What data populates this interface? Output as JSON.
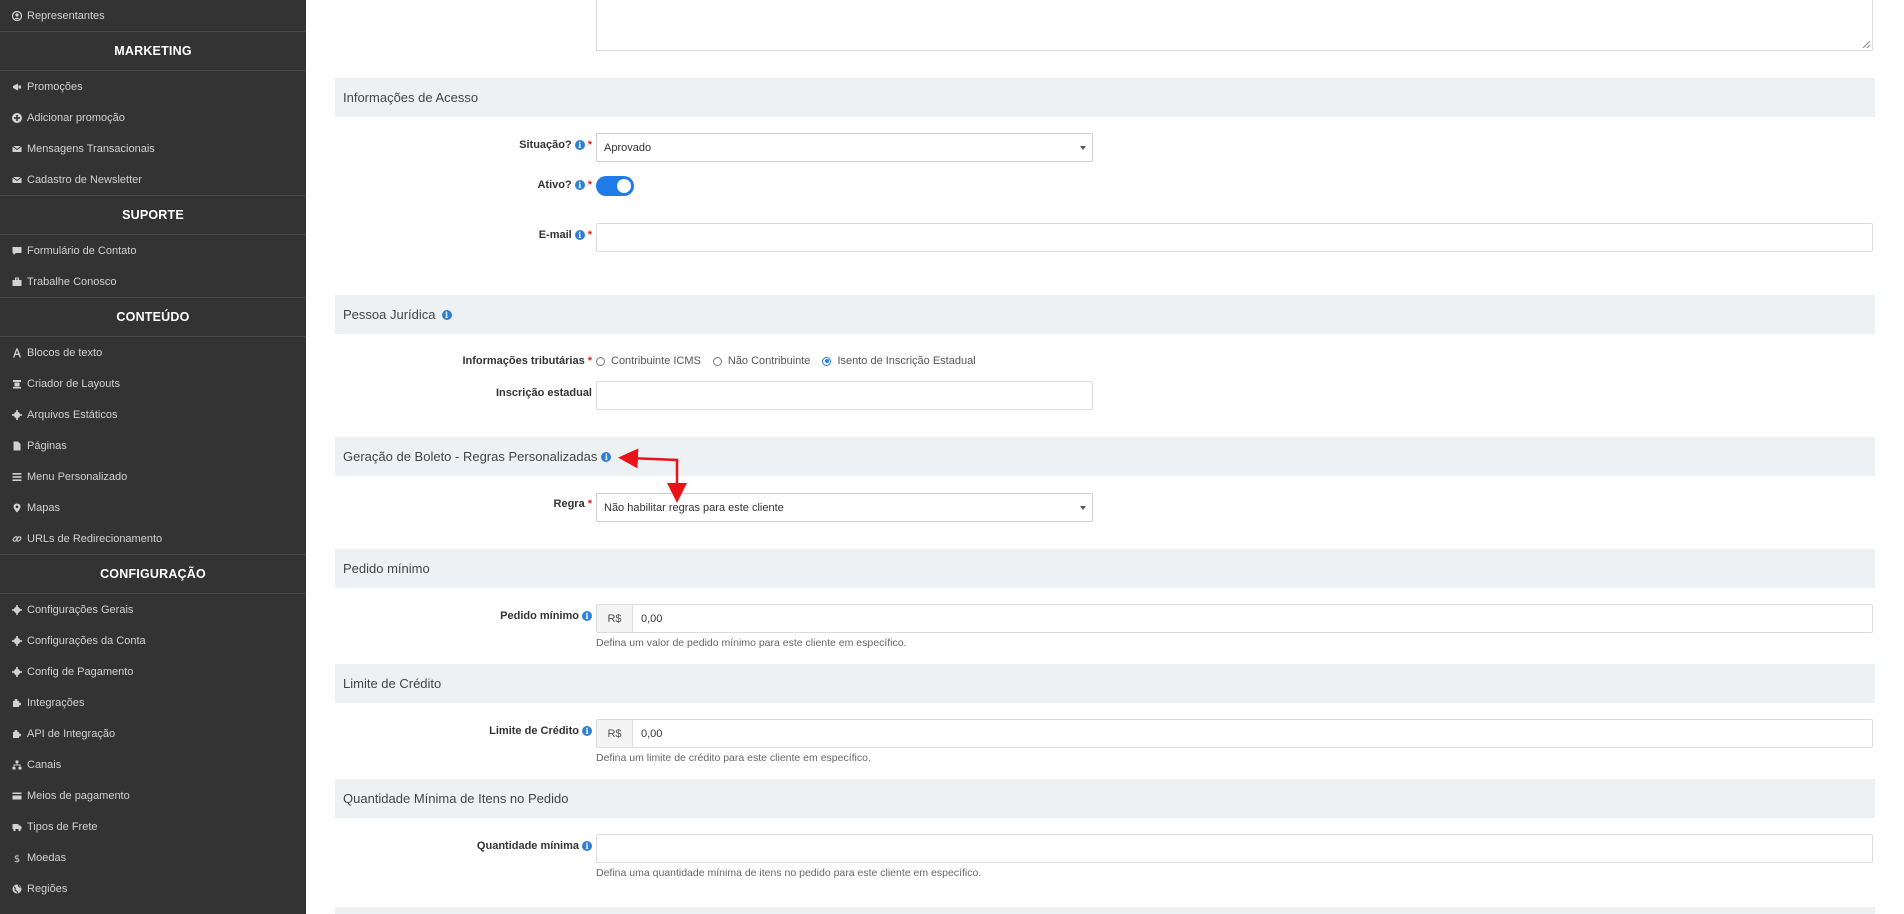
{
  "sidebar": {
    "entries": [
      {
        "kind": "item",
        "label": "Representantes",
        "icon": "user-circle-icon"
      },
      {
        "kind": "header",
        "label": "MARKETING"
      },
      {
        "kind": "item",
        "label": "Promoções",
        "icon": "megaphone-icon"
      },
      {
        "kind": "item",
        "label": "Adicionar promoção",
        "icon": "plus-circle-icon"
      },
      {
        "kind": "item",
        "label": "Mensagens Transacionais",
        "icon": "envelope-icon"
      },
      {
        "kind": "item",
        "label": "Cadastro de Newsletter",
        "icon": "envelope-icon"
      },
      {
        "kind": "header",
        "label": "SUPORTE"
      },
      {
        "kind": "item",
        "label": "Formulário de Contato",
        "icon": "comment-icon"
      },
      {
        "kind": "item",
        "label": "Trabalhe Conosco",
        "icon": "briefcase-icon"
      },
      {
        "kind": "header",
        "label": "CONTEÚDO"
      },
      {
        "kind": "item",
        "label": "Blocos de texto",
        "icon": "font-icon"
      },
      {
        "kind": "item",
        "label": "Criador de Layouts",
        "icon": "layout-icon"
      },
      {
        "kind": "item",
        "label": "Arquivos Estáticos",
        "icon": "gear-icon"
      },
      {
        "kind": "item",
        "label": "Páginas",
        "icon": "file-icon"
      },
      {
        "kind": "item",
        "label": "Menu Personalizado",
        "icon": "bars-icon"
      },
      {
        "kind": "item",
        "label": "Mapas",
        "icon": "map-marker-icon"
      },
      {
        "kind": "item",
        "label": "URLs de Redirecionamento",
        "icon": "link-icon"
      },
      {
        "kind": "header",
        "label": "CONFIGURAÇÃO"
      },
      {
        "kind": "item",
        "label": "Configurações Gerais",
        "icon": "gear-icon"
      },
      {
        "kind": "item",
        "label": "Configurações da Conta",
        "icon": "gear-icon"
      },
      {
        "kind": "item",
        "label": "Config de Pagamento",
        "icon": "gear-icon"
      },
      {
        "kind": "item",
        "label": "Integrações",
        "icon": "puzzle-icon"
      },
      {
        "kind": "item",
        "label": "API de Integração",
        "icon": "puzzle-icon"
      },
      {
        "kind": "item",
        "label": "Canais",
        "icon": "sitemap-icon"
      },
      {
        "kind": "item",
        "label": "Meios de pagamento",
        "icon": "credit-card-icon"
      },
      {
        "kind": "item",
        "label": "Tipos de Frete",
        "icon": "truck-icon"
      },
      {
        "kind": "item",
        "label": "Moedas",
        "icon": "dollar-icon"
      },
      {
        "kind": "item",
        "label": "Regiões",
        "icon": "globe-icon"
      }
    ]
  },
  "sections": {
    "acesso": {
      "title": "Informações de Acesso",
      "situacao_label": "Situação?",
      "situacao_value": "Aprovado",
      "ativo_label": "Ativo?",
      "ativo_on": true,
      "email_label": "E-mail",
      "email_value": ""
    },
    "pj": {
      "title": "Pessoa Jurídica",
      "trib_label": "Informações tributárias",
      "trib_options": [
        "Contribuinte ICMS",
        "Não Contribuinte",
        "Isento de Inscrição Estadual"
      ],
      "trib_selected": "Isento de Inscrição Estadual",
      "ie_label": "Inscrição estadual",
      "ie_value": ""
    },
    "boleto": {
      "title": "Geração de Boleto - Regras Personalizadas",
      "regra_label": "Regra",
      "regra_value": "Não habilitar regras para este cliente"
    },
    "pedido": {
      "title": "Pedido mínimo",
      "label": "Pedido mínimo",
      "currency": "R$",
      "value": "0,00",
      "help": "Defina um valor de pedido mínimo para este cliente em específico."
    },
    "credito": {
      "title": "Limite de Crédito",
      "label": "Limite de Crédito",
      "currency": "R$",
      "value": "0,00",
      "help": "Defina um limite de crédito para este cliente em específico."
    },
    "quantidade": {
      "title": "Quantidade Mínima de Itens no Pedido",
      "label": "Quantidade mínima",
      "value": "",
      "help": "Defina uma quantidade mínima de itens no pedido para este cliente em específico."
    }
  },
  "colors": {
    "sidebar_bg": "#333333",
    "accent": "#1e7be8",
    "required": "#e02020",
    "annotation_arrow": "#e8141a"
  }
}
